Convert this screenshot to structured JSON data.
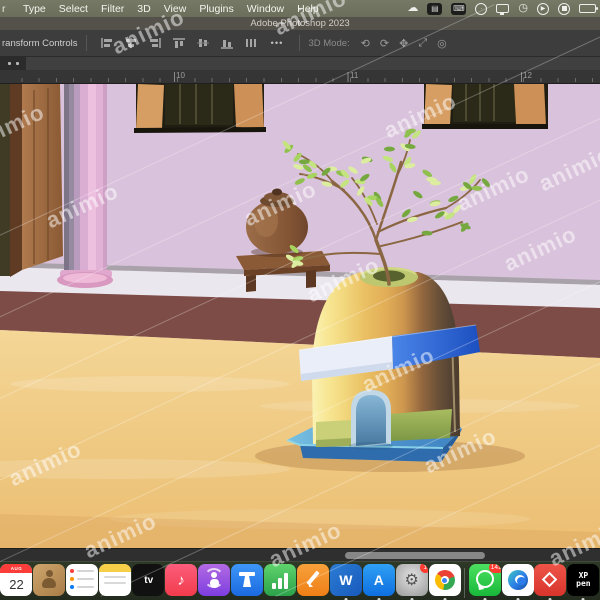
{
  "menubar": {
    "edge_fragment": "r",
    "menus": [
      "Type",
      "Select",
      "Filter",
      "3D",
      "View",
      "Plugins",
      "Window",
      "Help"
    ],
    "status_icons": [
      "creative-cloud",
      "dark-app-1",
      "dark-app-2",
      "clock-face",
      "display",
      "clock",
      "play-circle",
      "record-circle",
      "battery"
    ]
  },
  "titlebar": {
    "title": "Adobe Photoshop 2023"
  },
  "optionsbar": {
    "transform_label": "ransform Controls",
    "align_icons": [
      "align-left",
      "align-center-h",
      "align-right",
      "distribute-top",
      "distribute-middle",
      "distribute-bottom",
      "distribute-h"
    ],
    "ellipsis": "•••",
    "mode_label": "3D Mode:",
    "mode_icons": [
      "3d-orbit",
      "3d-roll",
      "3d-pan",
      "3d-slide",
      "3d-zoom"
    ]
  },
  "ruler": {
    "numbers": [
      "10",
      "11",
      "12"
    ]
  },
  "watermark": {
    "text": "animio"
  },
  "artwork": {
    "colors": {
      "wall_pink": "#d9c2db",
      "ledge_white": "#ebe7ee",
      "plinth_maroon": "#7d4c46",
      "floor_sand": "#eec77f",
      "hut_gold": "#e2ae57",
      "band_blue": "#2e66d2",
      "platform_blue": "#4f94cc",
      "leaf_green": "#9ccb53",
      "column_pink": "#e3b4d8",
      "pot_brown": "#8a5f3e"
    }
  },
  "scrollbar": {
    "orientation": "horizontal"
  },
  "dock": {
    "apps": [
      {
        "id": "calendar",
        "month": "AUG",
        "day": "22"
      },
      {
        "id": "contacts"
      },
      {
        "id": "reminders"
      },
      {
        "id": "notes"
      },
      {
        "id": "appletv",
        "label": "tv"
      },
      {
        "id": "music"
      },
      {
        "id": "podcasts"
      },
      {
        "id": "keynote"
      },
      {
        "id": "numbers"
      },
      {
        "id": "pages"
      },
      {
        "id": "word",
        "letter": "W"
      },
      {
        "id": "appstore",
        "letter": "A"
      },
      {
        "id": "settings",
        "badge": "1"
      },
      {
        "id": "chrome"
      },
      {
        "id": "whatsapp",
        "badge": "141"
      },
      {
        "id": "edge"
      },
      {
        "id": "red-diamond-app"
      },
      {
        "id": "xppen",
        "line1": "XP",
        "line2": "pen"
      }
    ]
  }
}
